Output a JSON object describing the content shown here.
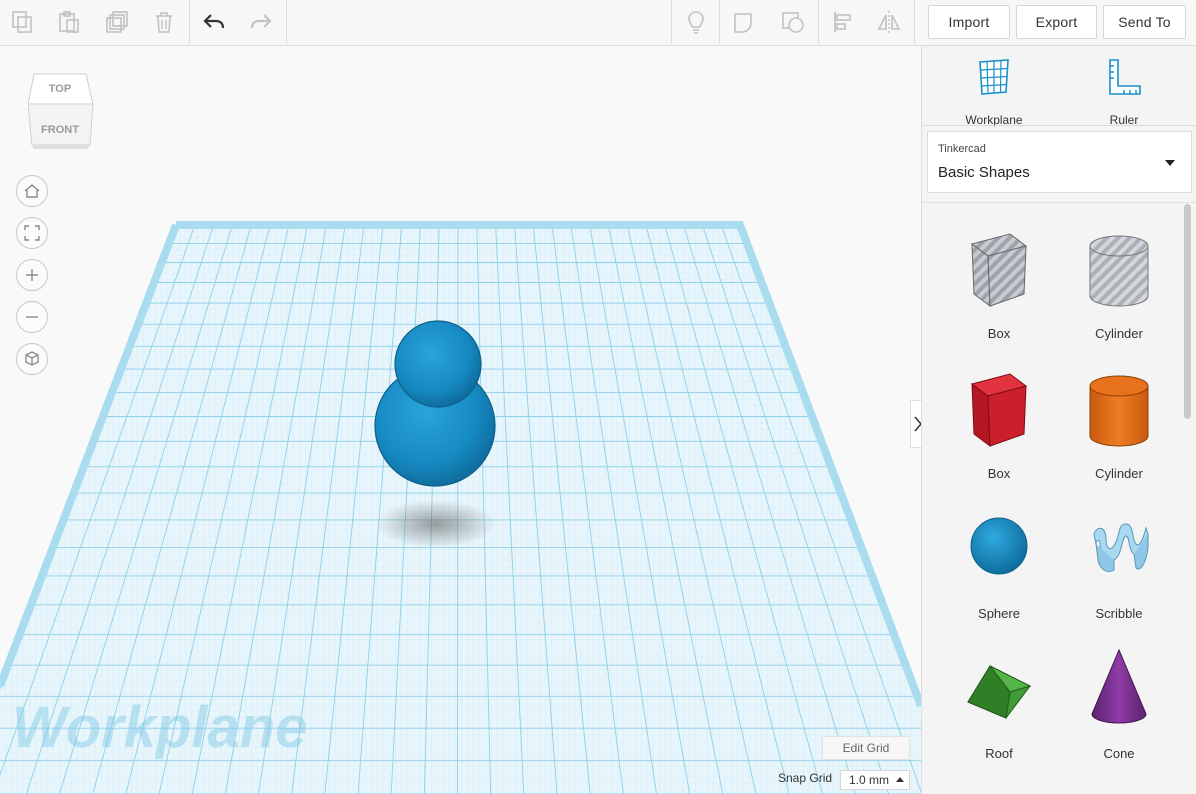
{
  "toolbar": {
    "import_label": "Import",
    "export_label": "Export",
    "send_to_label": "Send To"
  },
  "viewcube": {
    "top": "TOP",
    "front": "FRONT"
  },
  "workplane": {
    "watermark": "Workplane",
    "edit_grid": "Edit Grid"
  },
  "snap_grid": {
    "label": "Snap Grid",
    "value": "1.0 mm"
  },
  "panel": {
    "tools": [
      {
        "label": "Workplane",
        "icon": "workplane-icon"
      },
      {
        "label": "Ruler",
        "icon": "ruler-icon"
      }
    ],
    "library": {
      "category": "Tinkercad",
      "selected": "Basic Shapes"
    },
    "shapes": [
      {
        "label": "Box",
        "color": "#b7bcc4"
      },
      {
        "label": "Cylinder",
        "color": "#c4c8cf"
      },
      {
        "label": "Box",
        "color": "#cc1f2b"
      },
      {
        "label": "Cylinder",
        "color": "#e8711c"
      },
      {
        "label": "Sphere",
        "color": "#1a8fc9"
      },
      {
        "label": "Scribble",
        "color": "#9fd3ee"
      },
      {
        "label": "Roof",
        "color": "#3f9b35"
      },
      {
        "label": "Cone",
        "color": "#7d3491"
      }
    ]
  },
  "colors": {
    "accent": "#1a8fc9",
    "grid": "#a9dcef"
  }
}
